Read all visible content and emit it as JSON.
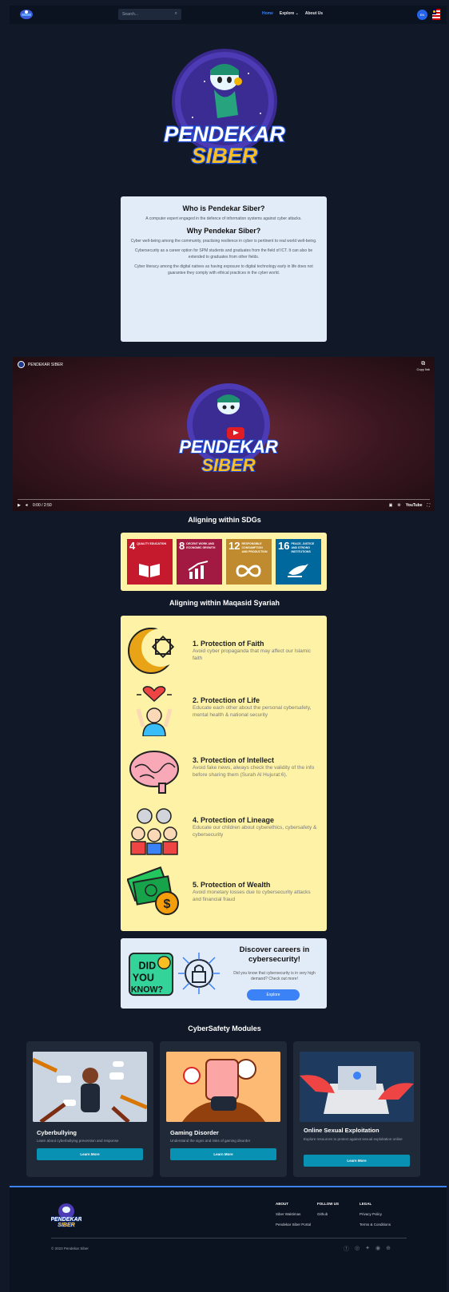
{
  "nav": {
    "search_placeholder": "Search...",
    "links": [
      "Home",
      "Explore",
      "About Us"
    ],
    "explore_caret": "⌄",
    "lang": "EN"
  },
  "hero": {
    "logo_text_1": "PENDEKAR",
    "logo_text_2": "SIBER"
  },
  "info": {
    "title1": "Who is Pendekar Siber?",
    "text1": "A computer expert engaged in the defence of information systems against cyber attacks.",
    "title2": "Why Pendekar Siber?",
    "text2": "Cyber well-being among the community, practising resilience in cyber is pertinent to real world well-being.",
    "text3": "Cybersecurity as a career option for SPM students and graduates from the field of ICT. It can also be extended to graduates from other fields.",
    "text4": "Cyber literacy among the digital natives as having exposure to digital technology early in life does not guarantee they comply with ethical practices in the cyber world."
  },
  "video": {
    "channel": "PENDEKAR SIBER",
    "copy_link": "Copy link",
    "time": "0:00 / 2:50",
    "youtube": "YouTube"
  },
  "sdg": {
    "title": "Aligning within SDGs",
    "goals": [
      {
        "num": "4",
        "label": "QUALITY EDUCATION",
        "color": "#c5192d"
      },
      {
        "num": "8",
        "label": "DECENT WORK AND ECONOMIC GROWTH",
        "color": "#a21942"
      },
      {
        "num": "12",
        "label": "RESPONSIBLE CONSUMPTION AND PRODUCTION",
        "color": "#bf8b2e"
      },
      {
        "num": "16",
        "label": "PEACE, JUSTICE AND STRONG INSTITUTIONS",
        "color": "#00689d"
      }
    ]
  },
  "maqasid": {
    "title": "Aligning within Maqasid Syariah",
    "items": [
      {
        "title": "1. Protection of Faith",
        "desc": "Avoid cyber propaganda that may affect our Islamic faith"
      },
      {
        "title": "2. Protection of Life",
        "desc": "Educate each other about the personal cybersafety, mental health & national security"
      },
      {
        "title": "3. Protection of Intellect",
        "desc": "Avoid fake news, always check the validity of the info before sharing them (Surah Al Hujurat:6)."
      },
      {
        "title": "4. Protection of Lineage",
        "desc": "Educate our children about cyberethics, cybersafety & cybersecurity"
      },
      {
        "title": "5. Protection of Wealth",
        "desc": "Avoid monetary losses due to cybersecurity attacks and financial fraud"
      }
    ]
  },
  "career": {
    "badge": "DID YOU KNOW?",
    "title": "Discover careers in cybersecurity!",
    "desc": "Did you know that cybersecurity is in very high demand? Check out more!",
    "button": "Explore"
  },
  "modules": {
    "title": "CyberSafety Modules",
    "cards": [
      {
        "title": "Cyberbullying",
        "desc": "Learn about cyberbullying prevention and response",
        "button": "Learn More"
      },
      {
        "title": "Gaming Disorder",
        "desc": "Understand the signs and risks of gaming disorder",
        "button": "Learn More"
      },
      {
        "title": "Online Sexual Exploitation",
        "desc": "Explore resources to protect against sexual exploitation online",
        "button": "Learn More"
      }
    ]
  },
  "footer": {
    "about_h": "ABOUT",
    "about_links": [
      "Siber Waktimas",
      "Pendekar Siber Portal"
    ],
    "follow_h": "FOLLOW US",
    "follow_links": [
      "Github"
    ],
    "legal_h": "LEGAL",
    "legal_links": [
      "Privacy Policy",
      "Terms & Conditions"
    ],
    "copyright": "© 2023 Pendekar Siber"
  }
}
